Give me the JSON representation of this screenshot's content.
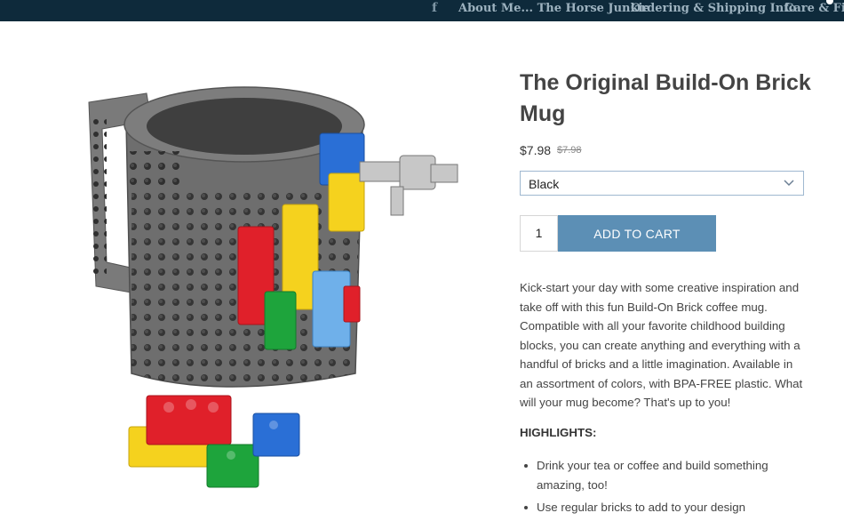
{
  "topbar": {
    "facebook_icon_label": "f",
    "nav": [
      "About Me... The Horse Junkie",
      "Ordering & Shipping Info",
      "Care & Fit I"
    ]
  },
  "product": {
    "title": "The Original Build-On Brick Mug",
    "price": "$7.98",
    "compare_price": "$7.98",
    "variant_selected": "Black",
    "quantity": "1",
    "add_to_cart_label": "ADD TO CART",
    "description": "Kick-start your day with some creative inspiration and take off with this fun Build-On Brick coffee mug. Compatible with all your favorite childhood building blocks, you can create anything and everything with a handful of bricks and a little imagination. Available in an assortment of colors, with BPA-FREE plastic. What will your mug become? That's up to you!",
    "highlights_title": "HIGHLIGHTS:",
    "highlights": [
      "Drink your tea or coffee and build something amazing, too!",
      "Use regular bricks to add to your design"
    ]
  },
  "colors": {
    "topbar": "#0e2a3b",
    "button": "#5c8fb5",
    "mug": "#6e6e6e",
    "brick_red": "#e0202a",
    "brick_yellow": "#f5d21e",
    "brick_blue": "#2a6fd6",
    "brick_green": "#1ea43c"
  }
}
